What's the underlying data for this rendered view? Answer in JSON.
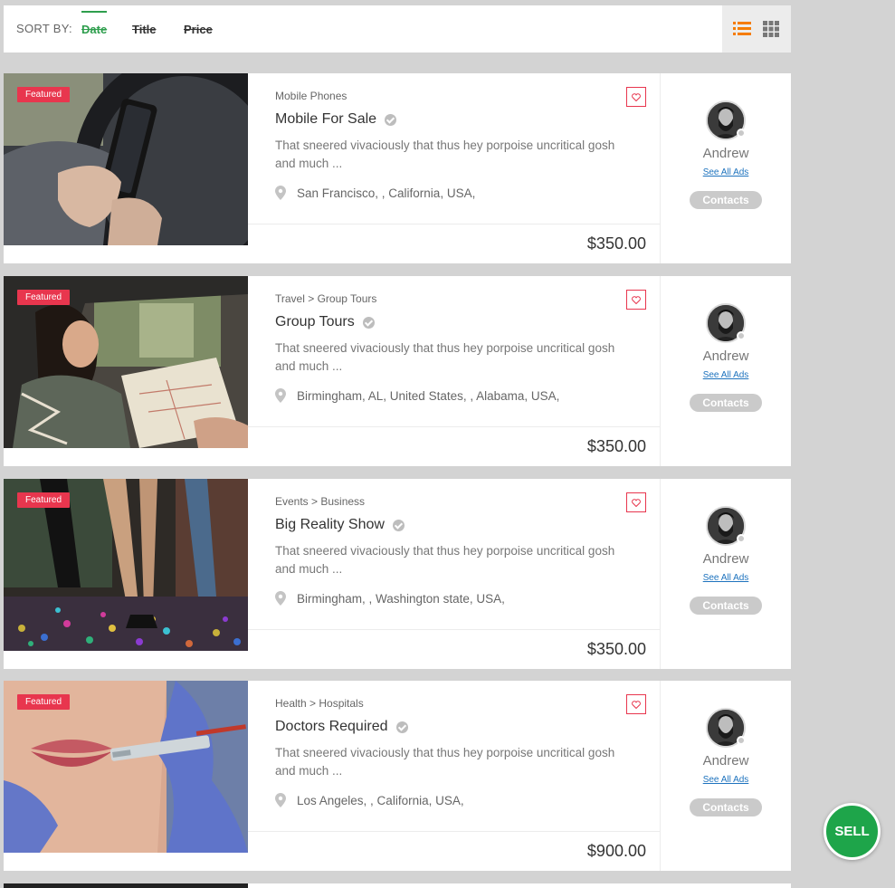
{
  "sort": {
    "label": "SORT BY:",
    "options": [
      "Date",
      "Title",
      "Price"
    ],
    "active": "Date"
  },
  "view": {
    "icons": [
      "list-view-icon",
      "grid-view-icon"
    ],
    "active": "list",
    "accent": "#f57c00"
  },
  "listings": [
    {
      "badge": "Featured",
      "category": "Mobile Phones",
      "title": "Mobile For Sale",
      "description": "That sneered vivaciously that thus hey porpoise uncritical gosh and much ...",
      "location": "San Francisco, , California, USA,",
      "price": "$350.00",
      "seller": {
        "name": "Andrew",
        "see_all": "See All Ads",
        "contacts": "Contacts"
      }
    },
    {
      "badge": "Featured",
      "category": "Travel > Group Tours",
      "title": "Group Tours",
      "description": "That sneered vivaciously that thus hey porpoise uncritical gosh and much ...",
      "location": "Birmingham, AL, United States, , Alabama, USA,",
      "price": "$350.00",
      "seller": {
        "name": "Andrew",
        "see_all": "See All Ads",
        "contacts": "Contacts"
      }
    },
    {
      "badge": "Featured",
      "category": "Events > Business",
      "title": "Big Reality Show",
      "description": "That sneered vivaciously that thus hey porpoise uncritical gosh and much ...",
      "location": "Birmingham, , Washington state, USA,",
      "price": "$350.00",
      "seller": {
        "name": "Andrew",
        "see_all": "See All Ads",
        "contacts": "Contacts"
      }
    },
    {
      "badge": "Featured",
      "category": "Health > Hospitals",
      "title": "Doctors Required",
      "description": "That sneered vivaciously that thus hey porpoise uncritical gosh and much ...",
      "location": "Los Angeles, , California, USA,",
      "price": "$900.00",
      "seller": {
        "name": "Andrew",
        "see_all": "See All Ads",
        "contacts": "Contacts"
      }
    }
  ],
  "sell_button": "SELL",
  "colors": {
    "green": "#1ea54a",
    "badge": "#e8364e",
    "link": "#1e73be"
  }
}
